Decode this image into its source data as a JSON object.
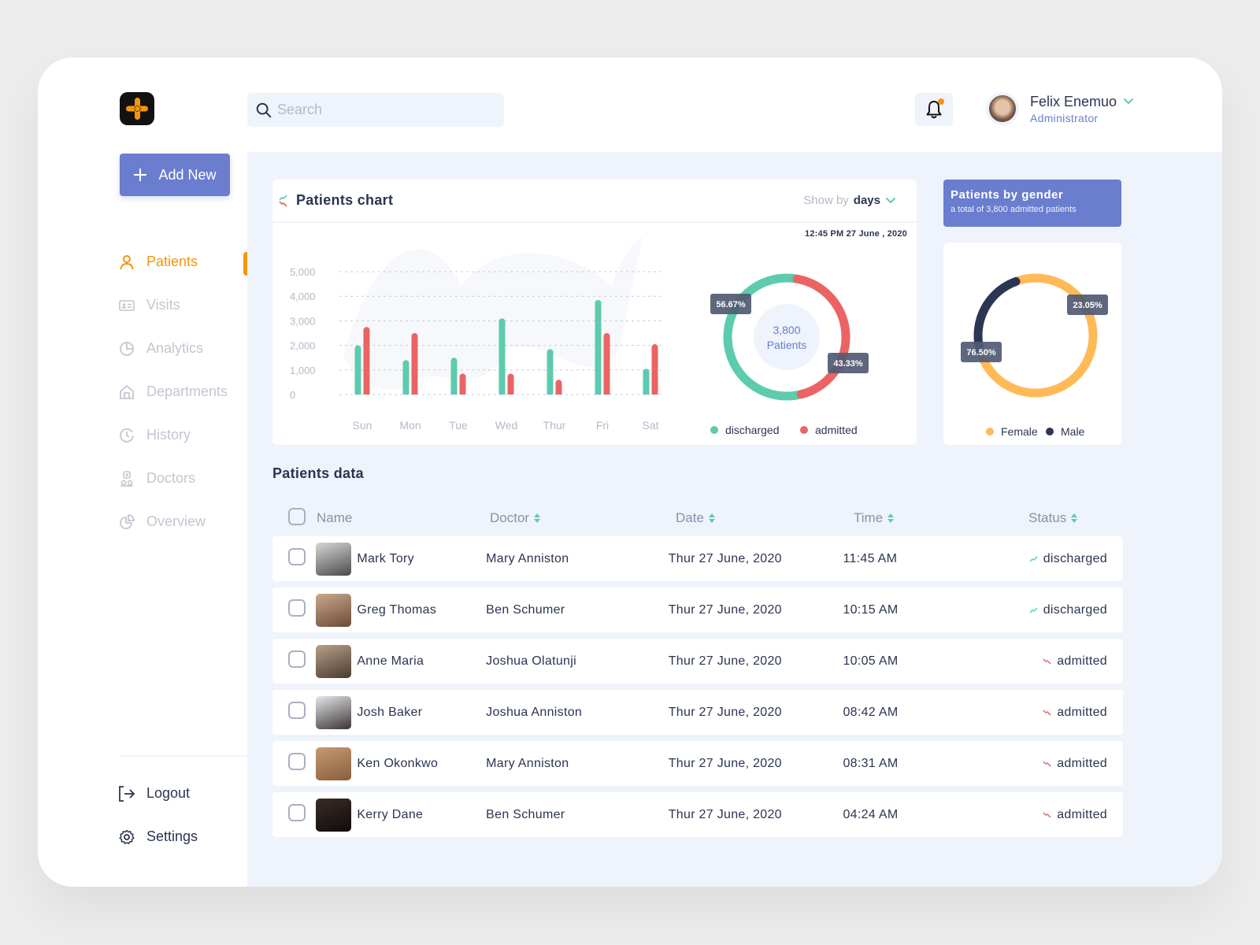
{
  "app": {
    "search_placeholder": "Search",
    "user": {
      "name": "Felix Enemuo",
      "role": "Administrator"
    },
    "notification_dot_color": "#f5950b",
    "add_new_label": "Add New"
  },
  "sidebar": {
    "items": [
      {
        "label": "Patients",
        "icon": "user-icon",
        "active": true
      },
      {
        "label": "Visits",
        "icon": "id-card-icon",
        "active": false
      },
      {
        "label": "Analytics",
        "icon": "pie-chart-icon",
        "active": false
      },
      {
        "label": "Departments",
        "icon": "home-icon",
        "active": false
      },
      {
        "label": "History",
        "icon": "history-clock-icon",
        "active": false
      },
      {
        "label": "Doctors",
        "icon": "doctor-icon",
        "active": false
      },
      {
        "label": "Overview",
        "icon": "overview-pie-icon",
        "active": false
      }
    ],
    "bottom": [
      {
        "label": "Logout",
        "icon": "logout-icon"
      },
      {
        "label": "Settings",
        "icon": "gear-icon"
      }
    ]
  },
  "colors": {
    "accent": "#6a7dcf",
    "active": "#f5950b",
    "discharged": "#5ccbae",
    "admitted": "#ea6464",
    "female": "#ffba57",
    "male": "#2c3654"
  },
  "patients_chart": {
    "title": "Patients chart",
    "show_by_label": "Show by",
    "show_by_value": "days",
    "timestamp": "12:45 PM 27 June , 2020"
  },
  "gender": {
    "title": "Patients by gender",
    "subtitle": "a total of 3,800 admitted patients"
  },
  "chart_data": [
    {
      "type": "bar",
      "title": "Patients chart",
      "categories": [
        "Sun",
        "Mon",
        "Tue",
        "Wed",
        "Thur",
        "Fri",
        "Sat"
      ],
      "series": [
        {
          "name": "discharged",
          "values": [
            2000,
            1400,
            1500,
            3100,
            1850,
            3850,
            1050
          ]
        },
        {
          "name": "admitted",
          "values": [
            2750,
            2500,
            850,
            850,
            600,
            2500,
            2050
          ]
        }
      ],
      "yticks": [
        "0",
        "1,000",
        "2,000",
        "3,000",
        "4,000",
        "5,000"
      ],
      "ylim": [
        0,
        5000
      ],
      "grid": true,
      "xlabel": "",
      "ylabel": ""
    },
    {
      "type": "pie",
      "variant": "donut",
      "center_value": "3,800",
      "center_label": "Patients",
      "slices": [
        {
          "name": "discharged",
          "value": 56.67,
          "label": "56.67%"
        },
        {
          "name": "admitted",
          "value": 43.33,
          "label": "43.33%"
        }
      ],
      "legend": [
        "discharged",
        "admitted"
      ],
      "legend_position": "bottom"
    },
    {
      "type": "pie",
      "variant": "donut",
      "title": "Patients by gender",
      "slices": [
        {
          "name": "Female",
          "value": 76.5,
          "label": "76.50%"
        },
        {
          "name": "Male",
          "value": 23.05,
          "label": "23.05%"
        }
      ],
      "legend": [
        "Female",
        "Male"
      ],
      "legend_position": "bottom"
    }
  ],
  "table": {
    "title": "Patients data",
    "columns": [
      "Name",
      "Doctor",
      "Date",
      "Time",
      "Status"
    ],
    "rows": [
      {
        "name": "Mark Tory",
        "doctor": "Mary Anniston",
        "date": "Thur 27 June, 2020",
        "time": "11:45 AM",
        "status": "discharged",
        "avatar": "linear-gradient(160deg,#d8d8d8,#4a4a4a)"
      },
      {
        "name": "Greg Thomas",
        "doctor": "Ben Schumer",
        "date": "Thur 27 June, 2020",
        "time": "10:15 AM",
        "status": "discharged",
        "avatar": "linear-gradient(160deg,#c9a98c,#6b4a36)"
      },
      {
        "name": "Anne Maria",
        "doctor": "Joshua Olatunji",
        "date": "Thur 27 June, 2020",
        "time": "10:05 AM",
        "status": "admitted",
        "avatar": "linear-gradient(160deg,#b8a089,#4a3a30)"
      },
      {
        "name": "Josh Baker",
        "doctor": "Joshua Anniston",
        "date": "Thur 27 June, 2020",
        "time": "08:42 AM",
        "status": "admitted",
        "avatar": "linear-gradient(160deg,#e5e7ea,#3b3533)"
      },
      {
        "name": "Ken Okonkwo",
        "doctor": "Mary Anniston",
        "date": "Thur 27 June, 2020",
        "time": "08:31 AM",
        "status": "admitted",
        "avatar": "linear-gradient(160deg,#c79a74,#8a5e3d)"
      },
      {
        "name": "Kerry Dane",
        "doctor": "Ben Schumer",
        "date": "Thur 27 June, 2020",
        "time": "04:24 AM",
        "status": "admitted",
        "avatar": "linear-gradient(160deg,#3a2c28,#0f0c0b)"
      }
    ]
  }
}
